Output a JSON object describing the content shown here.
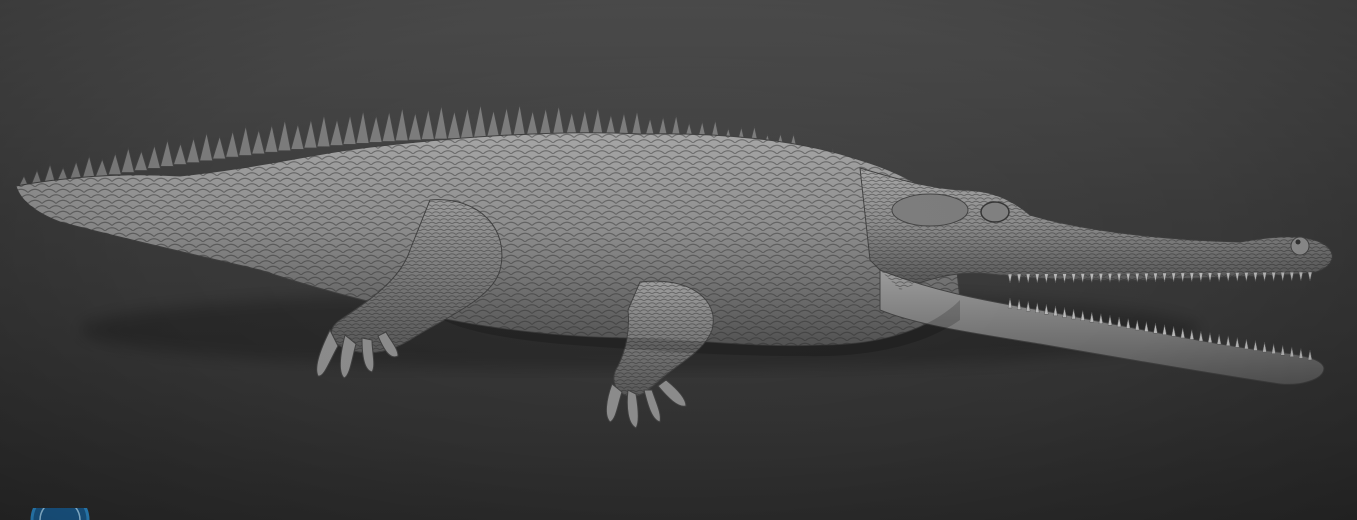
{
  "scene": {
    "subject_icon": "gharial-sculpt-icon",
    "logo_icon": "app-logo-icon",
    "colors": {
      "background_top": "#4a4a4a",
      "background_bottom": "#2c2c2c",
      "sculpt_base": "#8a8a8a",
      "sculpt_shadow": "#4d4d4d",
      "logo_accent": "#2f8fd0"
    }
  }
}
